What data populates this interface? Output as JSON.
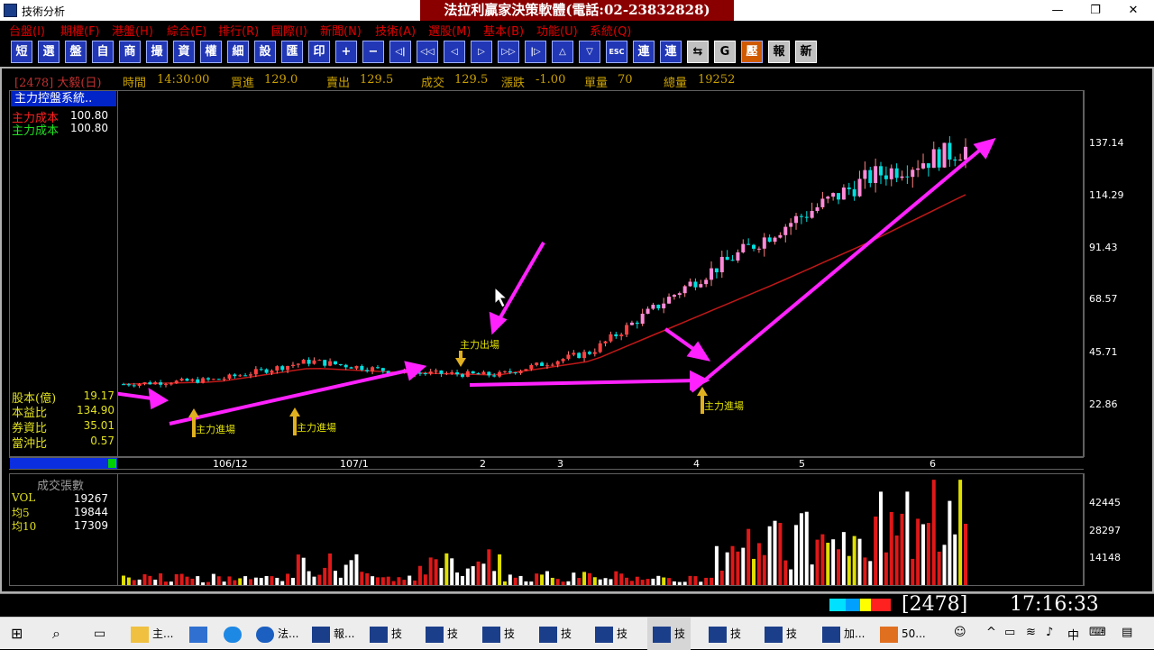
{
  "window": {
    "title": "技術分析",
    "banner": "法拉利贏家決策軟體(電話:02-23832828)"
  },
  "menu": [
    "台盤(I)",
    "期權(F)",
    "港盤(H)",
    "綜合(E)",
    "排行(R)",
    "國際(I)",
    "新聞(N)",
    "技術(A)",
    "選股(M)",
    "基本(B)",
    "功能(U)",
    "系統(Q)"
  ],
  "toolbar": [
    "短",
    "選",
    "盤",
    "自",
    "商",
    "撮",
    "資",
    "權",
    "細",
    "設",
    "匯",
    "印",
    "+",
    "−",
    "◁|",
    "◁◁",
    "◁",
    "▷",
    "▷▷",
    "|▷",
    "△",
    "▽",
    "ESC",
    "連",
    "連",
    "⇆",
    "G",
    "壓",
    "報",
    "新"
  ],
  "infobar": {
    "stock": "[2478] 大毅(日)",
    "time_label": "時間",
    "time": "14:30:00",
    "bid_label": "買進",
    "bid": "129.0",
    "ask_label": "賣出",
    "ask": "129.5",
    "deal_label": "成交",
    "deal": "129.5",
    "change_label": "漲跌",
    "change": "-1.00",
    "qty_label": "單量",
    "qty": "70",
    "total_label": "總量",
    "total": "19252"
  },
  "left_panel": {
    "system_title": "主力控盤系統..",
    "cost1_label": "主力成本",
    "cost1": "100.80",
    "cost2_label": "主力成本",
    "cost2": "100.80",
    "capital_label": "股本(億)",
    "capital": "19.17",
    "pe_label": "本益比",
    "pe": "134.90",
    "margin_label": "券資比",
    "margin": "35.01",
    "daytrade_label": "當沖比",
    "daytrade": "0.57"
  },
  "price_axis": [
    "137.14",
    "114.29",
    "91.43",
    "68.57",
    "45.71",
    "22.86"
  ],
  "date_axis": [
    "106/12",
    "107/1",
    "2",
    "3",
    "4",
    "5",
    "6"
  ],
  "annotations": {
    "enter": "主力進場",
    "exit": "主力出場"
  },
  "volume_panel": {
    "title": "成交張數",
    "vol_label": "VOL",
    "vol": "19267",
    "ma5_label": "均5",
    "ma5": "19844",
    "ma10_label": "均10",
    "ma10": "17309",
    "axis": [
      "42445",
      "28297",
      "14148"
    ]
  },
  "status": {
    "code": "2478",
    "clock": "17:16:33"
  },
  "taskbar": {
    "items": [
      "主...",
      "法...",
      "報...",
      "技",
      "技",
      "技",
      "技",
      "技",
      "技",
      "技",
      "技",
      "加...",
      "50..."
    ],
    "ime": "中"
  },
  "colors": {
    "menu_red": "#e00000",
    "banner_red": "#8a0000",
    "magenta_arrow": "#ff22ff",
    "up_red": "#ff2020",
    "down_cyan": "#00e0e0"
  },
  "chart_data": {
    "type": "candlestick",
    "price_ylim": [
      0,
      150
    ],
    "volume_ylim": [
      0,
      50000
    ],
    "x": [
      "106/12",
      "107/1",
      "2",
      "3",
      "4",
      "5",
      "6"
    ],
    "close_approx": [
      28,
      30,
      38,
      33,
      32,
      42,
      70,
      95,
      118,
      130
    ],
    "ma_line_approx": [
      28,
      29,
      35,
      33,
      32,
      38,
      55,
      72,
      90,
      110
    ]
  }
}
